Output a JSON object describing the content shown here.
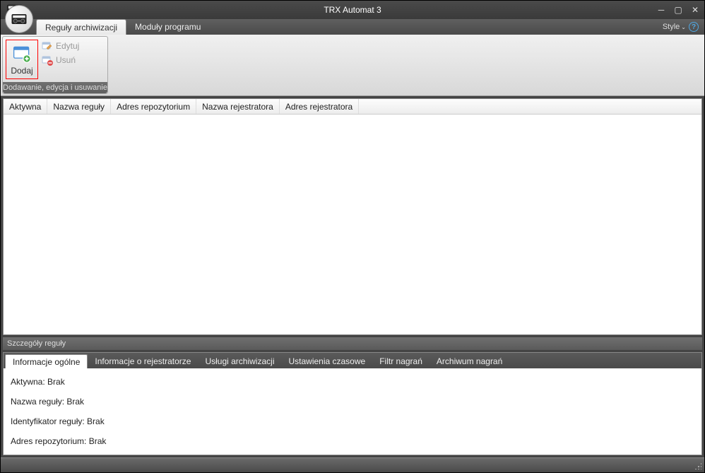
{
  "window": {
    "title": "TRX Automat 3"
  },
  "ribbon": {
    "tabs": [
      {
        "label": "Reguły archiwizacji",
        "active": true
      },
      {
        "label": "Moduły programu",
        "active": false
      }
    ],
    "style_label": "Style",
    "group_caption": "Dodawanie, edycja i usuwanie",
    "add_label": "Dodaj",
    "edit_label": "Edytuj",
    "delete_label": "Usuń"
  },
  "grid": {
    "columns": [
      "Aktywna",
      "Nazwa reguły",
      "Adres repozytorium",
      "Nazwa rejestratora",
      "Adres rejestratora"
    ]
  },
  "details": {
    "title": "Szczegóły reguły",
    "tabs": [
      "Informacje ogólne",
      "Informacje o rejestratorze",
      "Usługi archiwizacji",
      "Ustawienia czasowe",
      "Filtr nagrań",
      "Archiwum nagrań"
    ],
    "active_tab": 0,
    "rows": [
      "Aktywna: Brak",
      "Nazwa reguły: Brak",
      "Identyfikator reguły: Brak",
      "Adres repozytorium: Brak"
    ]
  }
}
